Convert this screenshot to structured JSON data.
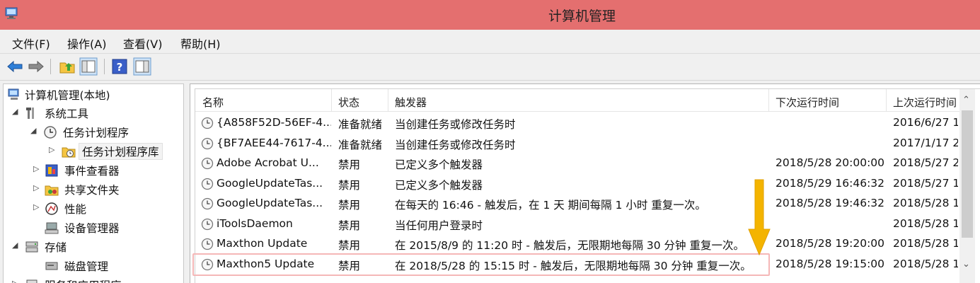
{
  "window": {
    "title": "计算机管理"
  },
  "menu": [
    "文件(F)",
    "操作(A)",
    "查看(V)",
    "帮助(H)"
  ],
  "toolbar": {
    "buttons": [
      "back-arrow-icon",
      "forward-arrow-icon",
      "up-folder-icon",
      "show-hide-console-tree-icon",
      "help-icon",
      "show-hide-action-pane-icon"
    ]
  },
  "tree": [
    {
      "label": "计算机管理(本地)",
      "icon": "computer-management-icon",
      "arrow": ""
    },
    {
      "label": "系统工具",
      "icon": "tools-icon",
      "arrow": "◢"
    },
    {
      "label": "任务计划程序",
      "icon": "clock-icon",
      "arrow": "◢"
    },
    {
      "label": "任务计划程序库",
      "icon": "task-library-icon",
      "arrow": "▷"
    },
    {
      "label": "事件查看器",
      "icon": "event-viewer-icon",
      "arrow": "▷"
    },
    {
      "label": "共享文件夹",
      "icon": "shared-folder-icon",
      "arrow": "▷"
    },
    {
      "label": "性能",
      "icon": "performance-icon",
      "arrow": "▷"
    },
    {
      "label": "设备管理器",
      "icon": "device-manager-icon",
      "arrow": ""
    },
    {
      "label": "存储",
      "icon": "storage-icon",
      "arrow": "◢"
    },
    {
      "label": "磁盘管理",
      "icon": "disk-management-icon",
      "arrow": ""
    },
    {
      "label": "服务和应用程序",
      "icon": "services-icon",
      "arrow": "▷"
    }
  ],
  "table": {
    "columns": [
      "名称",
      "状态",
      "触发器",
      "下次运行时间",
      "上次运行时间"
    ],
    "rows": [
      {
        "name": "{A858F52D-56EF-4...",
        "status": "准备就绪",
        "trigger": "当创建任务或修改任务时",
        "next": "",
        "last": "2016/6/27 1"
      },
      {
        "name": "{BF7AEE44-7617-4...",
        "status": "准备就绪",
        "trigger": "当创建任务或修改任务时",
        "next": "",
        "last": "2017/1/17 2"
      },
      {
        "name": "Adobe Acrobat U...",
        "status": "禁用",
        "trigger": "已定义多个触发器",
        "next": "2018/5/28 20:00:00",
        "last": "2018/5/27 2"
      },
      {
        "name": "GoogleUpdateTas...",
        "status": "禁用",
        "trigger": "已定义多个触发器",
        "next": "2018/5/29 16:46:32",
        "last": "2018/5/27 1"
      },
      {
        "name": "GoogleUpdateTas...",
        "status": "禁用",
        "trigger": "在每天的 16:46 - 触发后，在 1 天 期间每隔 1 小时 重复一次。",
        "next": "2018/5/28 19:46:32",
        "last": "2018/5/28 1"
      },
      {
        "name": "iToolsDaemon",
        "status": "禁用",
        "trigger": "当任何用户登录时",
        "next": "",
        "last": "2018/5/28 1"
      },
      {
        "name": "Maxthon Update",
        "status": "禁用",
        "trigger": "在 2015/8/9 的 11:20 时 - 触发后，无限期地每隔 30 分钟 重复一次。",
        "next": "2018/5/28 19:20:00",
        "last": "2018/5/28 1"
      },
      {
        "name": "Maxthon5 Update",
        "status": "禁用",
        "trigger": "在 2018/5/28 的 15:15 时 - 触发后，无限期地每隔 30 分钟 重复一次。",
        "next": "2018/5/28 19:15:00",
        "last": "2018/5/28 1"
      }
    ],
    "highlighted_row": 7
  },
  "colors": {
    "titlebar": "#e46f6f",
    "annotation_arrow": "#f4b400",
    "highlight_border": "#f5b7b7"
  }
}
